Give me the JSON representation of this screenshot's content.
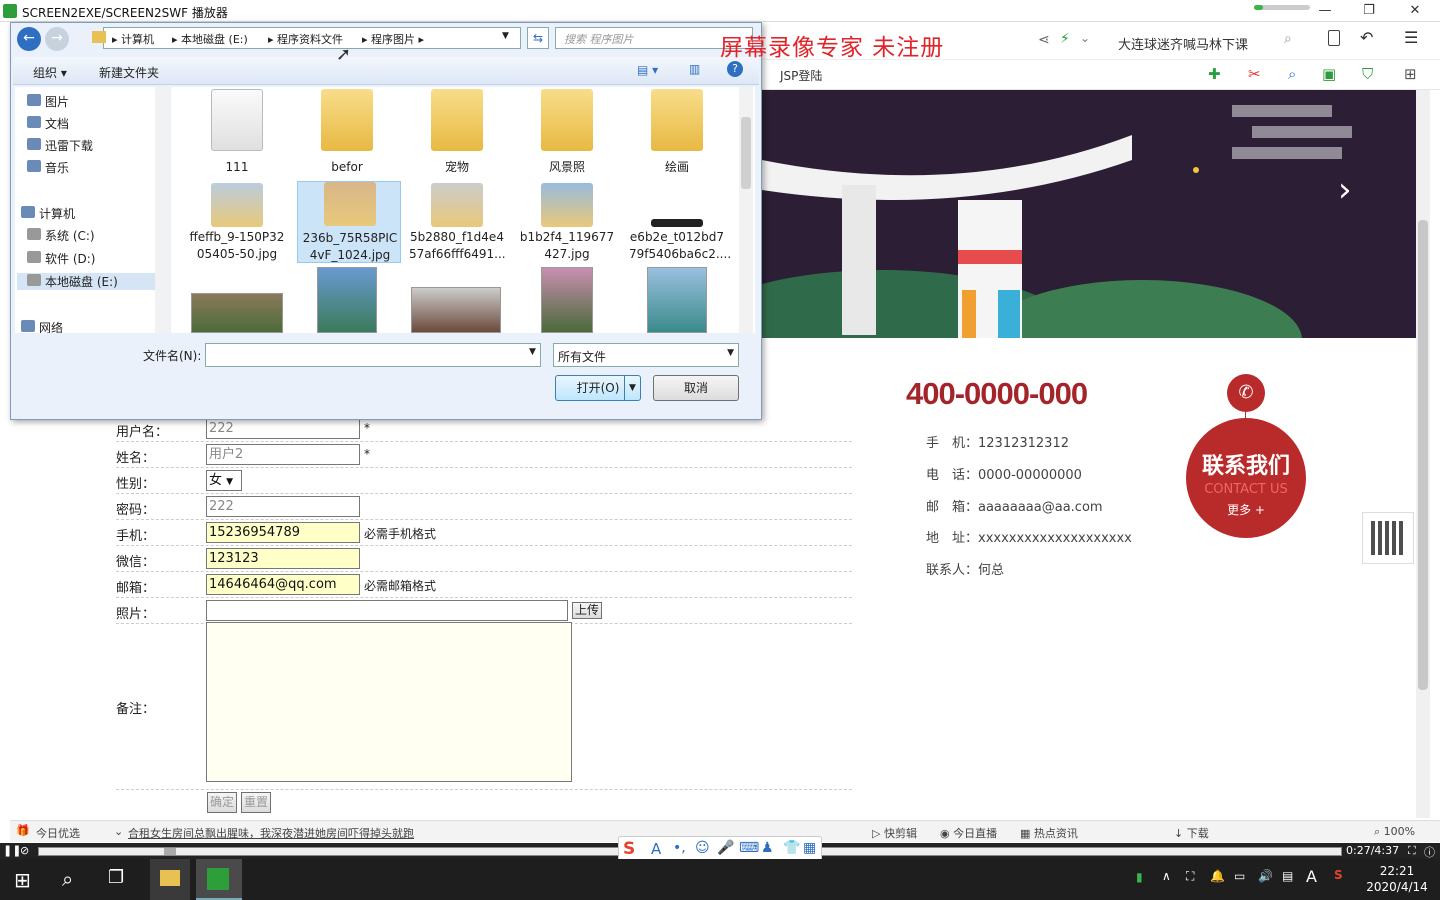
{
  "player": {
    "title": "SCREEN2EXE/SCREEN2SWF 播放器",
    "progress": 0.16,
    "window_buttons": [
      "—",
      "❐",
      "✕"
    ]
  },
  "watermark": "屏幕录像专家 未注册",
  "browser": {
    "news": "大连球迷齐喊马林下课",
    "tab_label": "JSP登陆"
  },
  "contact": {
    "phone_big": "400-0000-000",
    "lines": [
      "手　机：12312312312",
      "电　话：0000-00000000",
      "邮　箱：aaaaaaaa@aa.com",
      "地　址：xxxxxxxxxxxxxxxxxxxx",
      "联系人：何总"
    ],
    "badge_title": "联系我们",
    "badge_sub": "CONTACT US",
    "badge_more": "更多 +"
  },
  "form": {
    "rows": [
      {
        "label": "用户名：",
        "value": "222",
        "note": "*",
        "yellow": false
      },
      {
        "label": "姓名：",
        "value": "用户2",
        "note": "*",
        "yellow": false
      },
      {
        "label": "性别：",
        "value": "女",
        "note": "",
        "yellow": false
      },
      {
        "label": "密码：",
        "value": "222",
        "note": "",
        "yellow": false
      },
      {
        "label": "手机：",
        "value": "15236954789",
        "note": "必需手机格式",
        "yellow": true
      },
      {
        "label": "微信：",
        "value": "123123",
        "note": "",
        "yellow": true
      },
      {
        "label": "邮箱：",
        "value": "14646464@qq.com",
        "note": "必需邮箱格式",
        "yellow": true
      }
    ],
    "photo_label": "照片：",
    "upload_label": "上传",
    "remark_label": "备注：",
    "confirm_label": "确定",
    "reset_label": "重置"
  },
  "dialog": {
    "breadcrumb": [
      "计算机",
      "本地磁盘 (E:)",
      "程序资料文件",
      "程序图片"
    ],
    "search_placeholder": "搜索 程序图片",
    "organize": "组织 ▾",
    "new_folder": "新建文件夹",
    "nav": [
      "图片",
      "文档",
      "迅雷下载",
      "音乐",
      "计算机",
      "系统 (C:)",
      "软件 (D:)",
      "本地磁盘 (E:)",
      "网络"
    ],
    "files_row1": [
      "111",
      "befor",
      "宠物",
      "风景照",
      "绘画"
    ],
    "files_row2": [
      [
        "ffeffb_9-150P32",
        "05405-50.jpg"
      ],
      [
        "236b_75R58PIC",
        "4vF_1024.jpg"
      ],
      [
        "5b2880_f1d4e4",
        "57af66fff6491..."
      ],
      [
        "b1b2f4_119677",
        "427.jpg"
      ],
      [
        "e6b2e_t012bd7",
        "79f5406ba6c2...."
      ]
    ],
    "filename_label": "文件名(N):",
    "filename_value": "",
    "filetype": "所有文件",
    "open_label": "打开(O)",
    "cancel_label": "取消"
  },
  "statusbar": {
    "today": "今日优选",
    "headline": "合租女生房间总飘出腥味，我深夜潜进她房间吓得掉头就跑",
    "items": [
      "快剪辑",
      "今日直播",
      "热点资讯",
      "下载"
    ],
    "zoom": "100%"
  },
  "seek": {
    "time": "0:27/4:37",
    "position": 0.097
  },
  "taskbar": {
    "time": "22:21",
    "date": "2020/4/14",
    "ime": "A"
  }
}
